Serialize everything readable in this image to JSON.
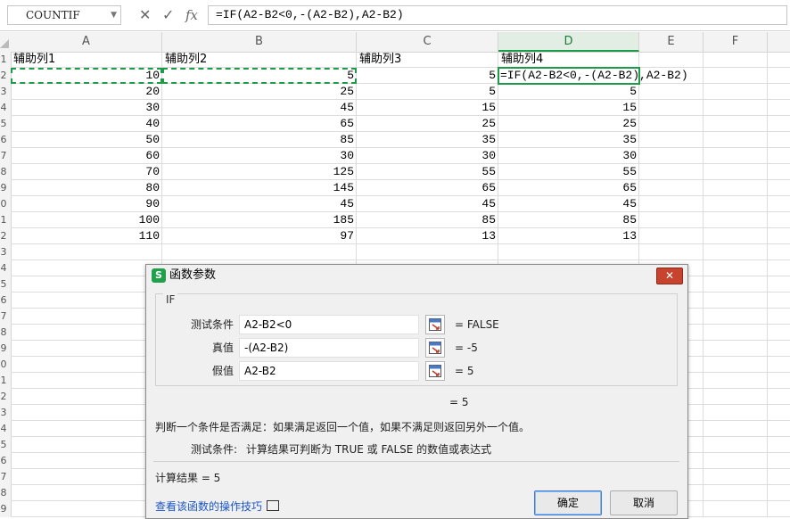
{
  "formula_bar": {
    "name_box": "COUNTIF",
    "cancel_glyph": "✕",
    "accept_glyph": "✓",
    "fx_glyph": "fx",
    "formula": "=IF(A2-B2<0,-(A2-B2),A2-B2)"
  },
  "columns": [
    "A",
    "B",
    "C",
    "D",
    "E",
    "F"
  ],
  "row_numbers": [
    "1",
    "2",
    "3",
    "4",
    "5",
    "6",
    "7",
    "8",
    "9",
    "0",
    "1",
    "2",
    "3",
    "4",
    "5",
    "6",
    "7",
    "8",
    "9",
    "0",
    "1",
    "2",
    "3",
    "4",
    "5",
    "6",
    "7",
    "8",
    "9"
  ],
  "sheet": {
    "headers": [
      "辅助列1",
      "辅助列2",
      "辅助列3",
      "辅助列4"
    ],
    "rows": [
      {
        "a": "10",
        "b": "5",
        "c": "5",
        "d": "=IF(A2-B2<0,-(A2-B2),A2-B2)"
      },
      {
        "a": "20",
        "b": "25",
        "c": "5",
        "d": "5"
      },
      {
        "a": "30",
        "b": "45",
        "c": "15",
        "d": "15"
      },
      {
        "a": "40",
        "b": "65",
        "c": "25",
        "d": "25"
      },
      {
        "a": "50",
        "b": "85",
        "c": "35",
        "d": "35"
      },
      {
        "a": "60",
        "b": "30",
        "c": "30",
        "d": "30"
      },
      {
        "a": "70",
        "b": "125",
        "c": "55",
        "d": "55"
      },
      {
        "a": "80",
        "b": "145",
        "c": "65",
        "d": "65"
      },
      {
        "a": "90",
        "b": "45",
        "c": "45",
        "d": "45"
      },
      {
        "a": "100",
        "b": "185",
        "c": "85",
        "d": "85"
      },
      {
        "a": "110",
        "b": "97",
        "c": "13",
        "d": "13"
      }
    ]
  },
  "dialog": {
    "logo": "S",
    "title": "函数参数",
    "close_glyph": "✕",
    "function_name": "IF",
    "args": [
      {
        "label": "测试条件",
        "value": "A2-B2<0",
        "result": "= FALSE"
      },
      {
        "label": "真值",
        "value": "-(A2-B2)",
        "result": "= -5"
      },
      {
        "label": "假值",
        "value": "A2-B2",
        "result": "= 5"
      }
    ],
    "overall_result": "= 5",
    "description": "判断一个条件是否满足：如果满足返回一个值，如果不满足则返回另外一个值。",
    "param_desc_label": "测试条件:",
    "param_desc": "计算结果可判断为 TRUE 或 FALSE 的数值或表达式",
    "calc_result": "计算结果 = 5",
    "help_link": "查看该函数的操作技巧",
    "ok": "确定",
    "cancel": "取消"
  }
}
